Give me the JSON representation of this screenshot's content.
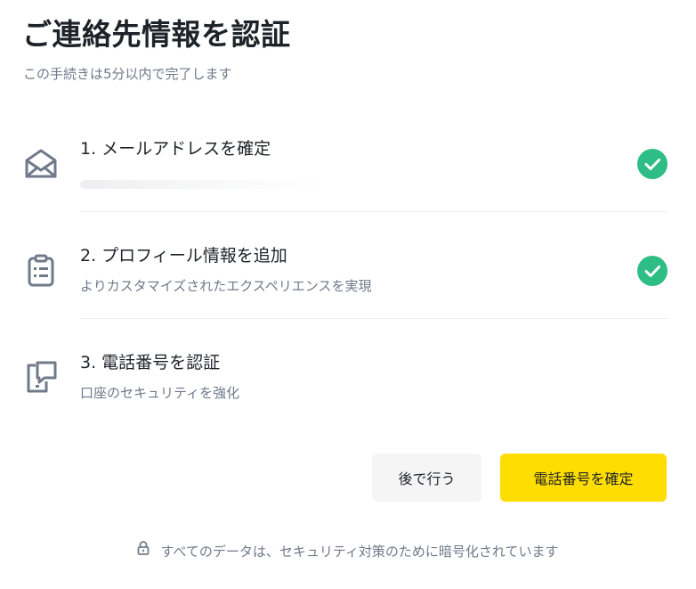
{
  "header": {
    "title": "ご連絡先情報を認証",
    "subtitle": "この手続きは5分以内で完了します"
  },
  "steps": [
    {
      "label": "1. メールアドレスを確定",
      "description": "",
      "icon": "envelope-icon",
      "completed": true
    },
    {
      "label": "2. プロフィール情報を追加",
      "description": "よりカスタマイズされたエクスペリエンスを実現",
      "icon": "clipboard-icon",
      "completed": true
    },
    {
      "label": "3. 電話番号を認証",
      "description": "口座のセキュリティを強化",
      "icon": "phone-message-icon",
      "completed": false
    }
  ],
  "actions": {
    "later_label": "後で行う",
    "confirm_label": "電話番号を確定"
  },
  "footer": {
    "security_note": "すべてのデータは、セキュリティ対策のために暗号化されています",
    "icon": "lock-icon"
  },
  "colors": {
    "primary_button": "#fedd00",
    "secondary_button": "#f5f5f5",
    "check": "#2ebd85",
    "muted_text": "#707a8a",
    "text": "#1e2329"
  }
}
